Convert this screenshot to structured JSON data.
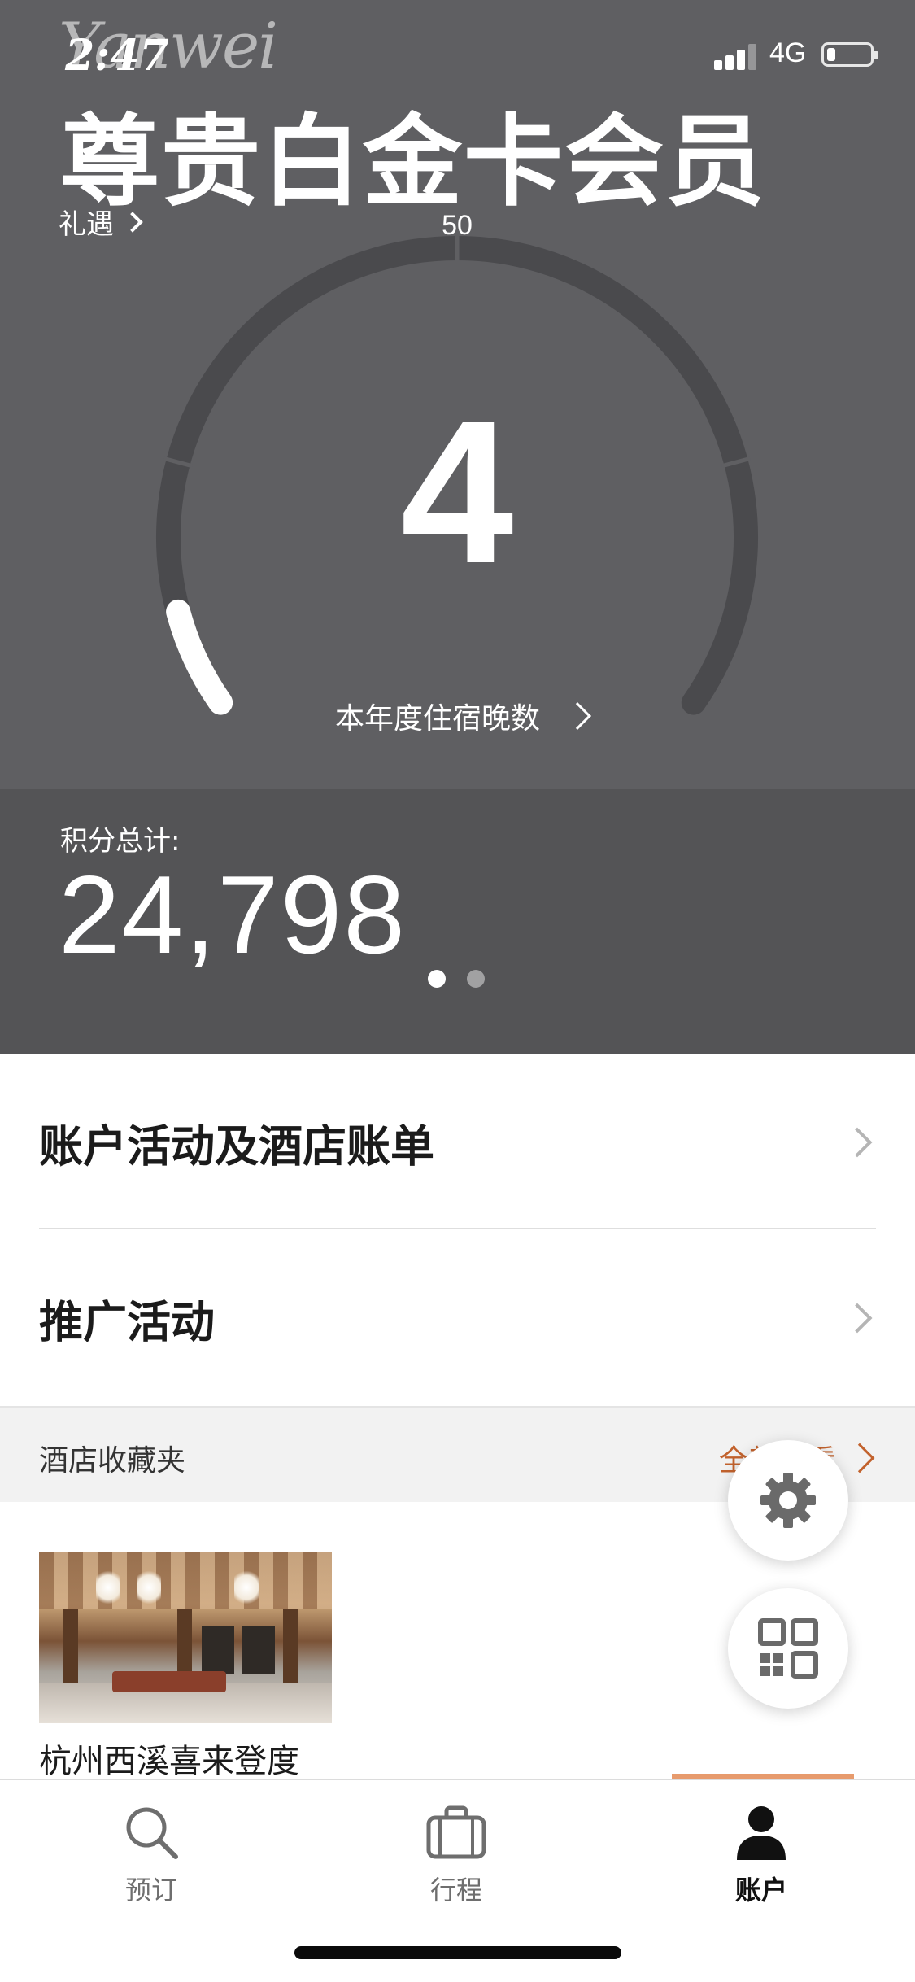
{
  "status_bar": {
    "time": "2:47",
    "watermark": "Yanwei",
    "network": "4G",
    "signal_bars": 3,
    "battery_level": 0.2
  },
  "hero": {
    "tier_title": "尊贵白金卡会员",
    "benefits_link": "礼遇",
    "gauge_max": "50",
    "nights_value": "4",
    "nights_caption": "本年度住宿晚数"
  },
  "points": {
    "label": "积分总计:",
    "value": "24,798",
    "pages": 2,
    "active_page": 0
  },
  "menu": {
    "items": [
      {
        "label": "账户活动及酒店账单"
      },
      {
        "label": "推广活动"
      }
    ]
  },
  "favorites": {
    "title": "酒店收藏夹",
    "view_all": "全部查看",
    "hotels": [
      {
        "name": "杭州西溪喜来登度"
      }
    ]
  },
  "tab_bar": {
    "tabs": [
      {
        "label": "预订",
        "icon": "search-icon",
        "active": false
      },
      {
        "label": "行程",
        "icon": "suitcase-icon",
        "active": false
      },
      {
        "label": "账户",
        "icon": "person-icon",
        "active": true
      }
    ]
  },
  "colors": {
    "hero_bg": "#5f5f62",
    "points_bg": "#545456",
    "accent": "#c2622d",
    "gauge_track": "#4a4a4d"
  }
}
